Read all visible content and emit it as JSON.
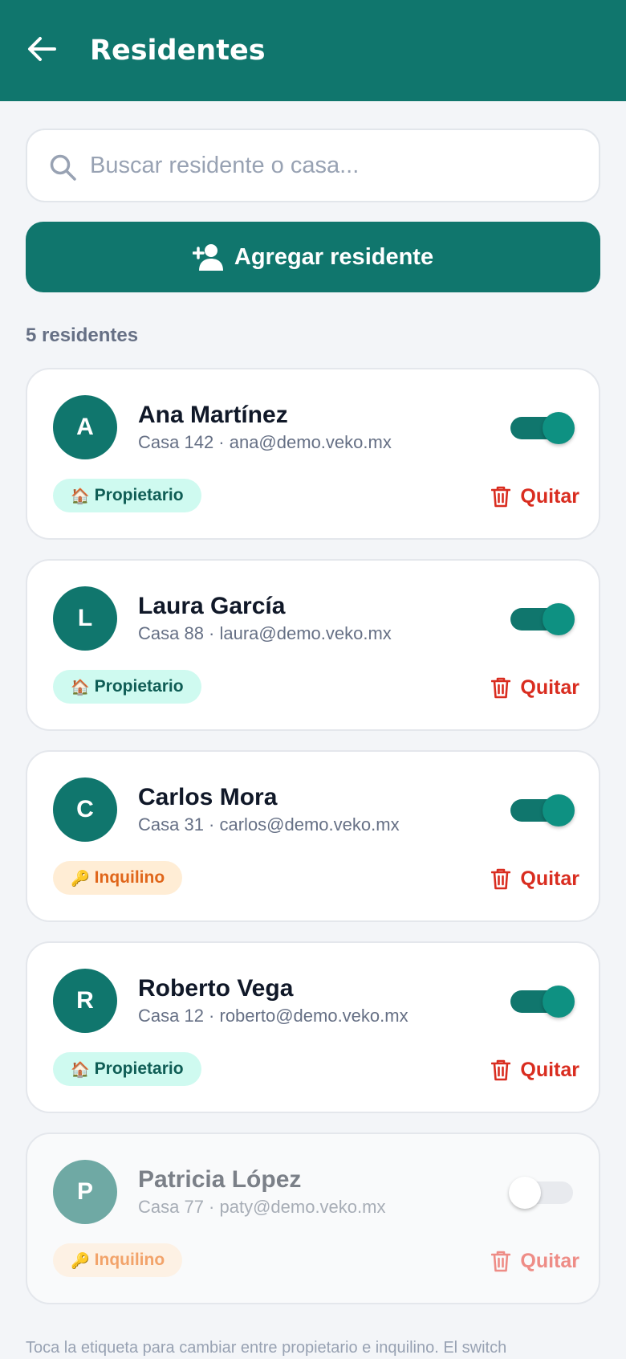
{
  "appbar": {
    "title": "Residentes"
  },
  "search": {
    "placeholder": "Buscar residente o casa..."
  },
  "add_button": {
    "label": "Agregar residente"
  },
  "count_label": "5 residentes",
  "colors": {
    "primary": "#10766d",
    "owner_tag": "#cffaf0",
    "tenant_tag": "#ffedd5",
    "danger": "#d92d20"
  },
  "residents": [
    {
      "initial": "A",
      "name": "Ana Martínez",
      "meta": "Casa 142 · ana@demo.veko.mx",
      "tag_emoji": "🏠",
      "tag": "Propietario",
      "active": true,
      "remove_label": "Quitar"
    },
    {
      "initial": "L",
      "name": "Laura García",
      "meta": "Casa 88 · laura@demo.veko.mx",
      "tag_emoji": "🏠",
      "tag": "Propietario",
      "active": true,
      "remove_label": "Quitar"
    },
    {
      "initial": "C",
      "name": "Carlos Mora",
      "meta": "Casa 31 · carlos@demo.veko.mx",
      "tag_emoji": "🔑",
      "tag": "Inquilino",
      "active": true,
      "remove_label": "Quitar"
    },
    {
      "initial": "R",
      "name": "Roberto Vega",
      "meta": "Casa 12 · roberto@demo.veko.mx",
      "tag_emoji": "🏠",
      "tag": "Propietario",
      "active": true,
      "remove_label": "Quitar"
    },
    {
      "initial": "P",
      "name": "Patricia López",
      "meta": "Casa 77 · paty@demo.veko.mx",
      "tag_emoji": "🔑",
      "tag": "Inquilino",
      "active": false,
      "remove_label": "Quitar"
    }
  ],
  "footnote": "Toca la etiqueta para cambiar entre propietario e inquilino. El switch"
}
